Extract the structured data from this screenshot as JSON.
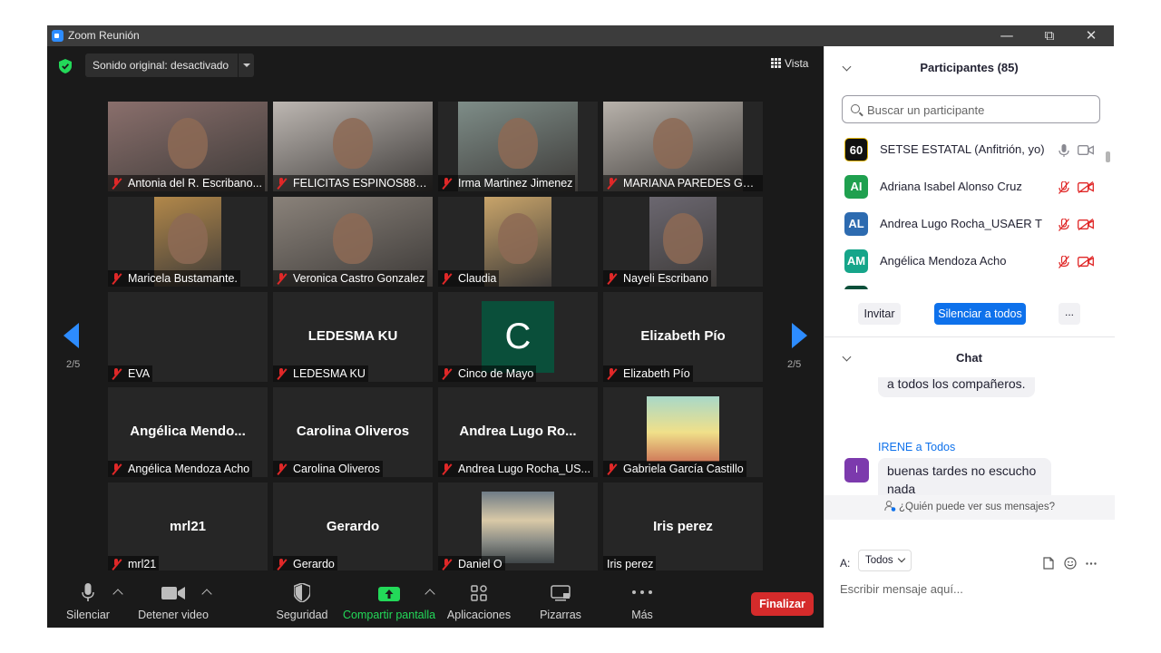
{
  "window": {
    "title": "Zoom Reunión",
    "controls": [
      "—",
      "⧉",
      "✕"
    ]
  },
  "topbar": {
    "sound_label": "Sonido original: desactivado",
    "view_label": "Vista"
  },
  "pagination": {
    "left": "2/5",
    "right": "2/5"
  },
  "tiles": [
    {
      "name": "Antonia del R. Escribano...",
      "kind": "video",
      "bg": "#8a6f6c",
      "muted": true
    },
    {
      "name": "FELICITAS ESPINOS88A P...",
      "kind": "video",
      "bg": "#bdb7b2",
      "muted": true
    },
    {
      "name": "Irma Martinez Jimenez",
      "kind": "video",
      "bg": "#7e8d88",
      "muted": true
    },
    {
      "name": "MARIANA PAREDES GUT...",
      "kind": "video",
      "bg": "#b8b2ab",
      "muted": true
    },
    {
      "name": "Maricela Bustamante.",
      "kind": "video",
      "bg": "#b2884a",
      "muted": true
    },
    {
      "name": "Veronica Castro Gonzalez",
      "kind": "video",
      "bg": "#8a827a",
      "muted": true
    },
    {
      "name": "Claudia",
      "kind": "video",
      "bg": "#c8a46a",
      "muted": true
    },
    {
      "name": "Nayeli Escribano",
      "kind": "video",
      "bg": "#6b6770",
      "muted": true
    },
    {
      "name": "EVA",
      "kind": "empty",
      "muted": true
    },
    {
      "name": "LEDESMA KU",
      "big": "LEDESMA KU",
      "kind": "name",
      "muted": true
    },
    {
      "name": "Cinco de Mayo",
      "kind": "letter",
      "letter": "C",
      "bg": "#0a4f3a",
      "muted": true
    },
    {
      "name": "Elizabeth Pío",
      "big": "Elizabeth Pío",
      "kind": "name",
      "muted": true
    },
    {
      "name": "Angélica Mendoza Acho",
      "big": "Angélica  Mendo...",
      "kind": "name",
      "muted": true
    },
    {
      "name": "Carolina Oliveros",
      "big": "Carolina Oliveros",
      "kind": "name",
      "muted": true
    },
    {
      "name": "Andrea Lugo Rocha_US...",
      "big": "Andrea Lugo Ro...",
      "kind": "name",
      "muted": true
    },
    {
      "name": "Gabriela García Castillo",
      "kind": "picture",
      "bg": "#7fb7a8",
      "muted": true
    },
    {
      "name": "mrl21",
      "big": "mrl21",
      "kind": "name",
      "muted": true
    },
    {
      "name": "Gerardo",
      "big": "Gerardo",
      "kind": "name",
      "muted": true
    },
    {
      "name": "Daniel O",
      "kind": "picture",
      "bg": "#8a8c86",
      "muted": true
    },
    {
      "name": "Iris perez",
      "big": "Iris perez",
      "kind": "name",
      "muted": false
    }
  ],
  "toolbar": {
    "mute": "Silenciar",
    "video": "Detener video",
    "security": "Seguridad",
    "share": "Compartir pantalla",
    "apps": "Aplicaciones",
    "whiteboard": "Pizarras",
    "more": "Más",
    "end": "Finalizar"
  },
  "participants": {
    "title": "Participantes (85)",
    "search_placeholder": "Buscar un participante",
    "list": [
      {
        "initials": "60",
        "name": "SETSE ESTATAL (Anfitrión, yo)",
        "color": "#111111"
      },
      {
        "initials": "AI",
        "name": "Adriana Isabel Alonso Cruz",
        "color": "#1fa04f"
      },
      {
        "initials": "AL",
        "name": "Andrea Lugo Rocha_USAER T",
        "color": "#2d6bb0"
      },
      {
        "initials": "AM",
        "name": "Angélica Mendoza Acho",
        "color": "#16a58a"
      }
    ],
    "invite": "Invitar",
    "mute_all": "Silenciar a todos",
    "more": "..."
  },
  "chat": {
    "title": "Chat",
    "prev_message": "a todos los compañeros.",
    "sender": "IRENE a Todos",
    "sender_initial": "I",
    "message_line1": "buenas tardes no escucho",
    "message_line2": "nada",
    "who_can_see": "¿Quién puede ver sus mensajes?",
    "to_label": "A:",
    "to_value": "Todos",
    "input_placeholder": "Escribir mensaje aquí..."
  }
}
